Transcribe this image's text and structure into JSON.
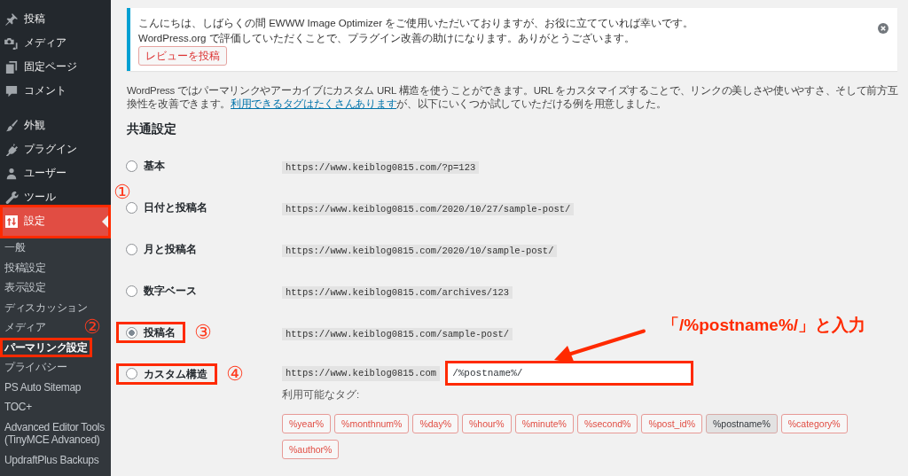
{
  "sidebar": {
    "groups": [
      {
        "items": [
          {
            "label": "投稿",
            "selected": false,
            "highlighted": false
          },
          {
            "label": "メディア",
            "selected": false,
            "highlighted": false
          },
          {
            "label": "固定ページ",
            "selected": false,
            "highlighted": false
          },
          {
            "label": "コメント",
            "selected": false,
            "highlighted": false
          }
        ]
      },
      {
        "items": [
          {
            "label": "外観",
            "selected": false,
            "highlighted": false
          },
          {
            "label": "プラグイン",
            "selected": false,
            "highlighted": false
          },
          {
            "label": "ユーザー",
            "selected": false,
            "highlighted": false
          },
          {
            "label": "ツール",
            "selected": false,
            "highlighted": false
          },
          {
            "label": "設定",
            "selected": true,
            "highlighted": true,
            "callout": "①",
            "submenu": [
              {
                "label": "一般",
                "selected": false,
                "highlighted": false
              },
              {
                "label": "投稿設定",
                "selected": false,
                "highlighted": false
              },
              {
                "label": "表示設定",
                "selected": false,
                "highlighted": false
              },
              {
                "label": "ディスカッション",
                "selected": false,
                "highlighted": false
              },
              {
                "label": "メディア",
                "selected": false,
                "highlighted": false
              },
              {
                "label": "パーマリンク設定",
                "selected": true,
                "highlighted": true,
                "callout": "②"
              },
              {
                "label": "プライバシー",
                "selected": false,
                "highlighted": false
              },
              {
                "label": "PS Auto Sitemap",
                "selected": false,
                "highlighted": false
              },
              {
                "label": "TOC+",
                "selected": false,
                "highlighted": false
              },
              {
                "label": "Advanced Editor Tools (TinyMCE Advanced)",
                "selected": false,
                "highlighted": false
              },
              {
                "label": "UpdraftPlus Backups",
                "selected": false,
                "highlighted": false
              }
            ]
          }
        ]
      }
    ]
  },
  "notice": {
    "lines": [
      "こんにちは、しばらくの間 EWWW Image Optimizer をご使用いただいておりますが、お役に立てていれば幸いです。",
      "WordPress.org で評価していただくことで、プラグイン改善の助けになります。ありがとうございます。"
    ],
    "button": "レビューを投稿"
  },
  "intro": {
    "text": "WordPress ではパーマリンクやアーカイブにカスタム URL 構造を使うことができます。URL をカスタマイズすることで、リンクの美しさや使いやすさ、そして前方互換性を改善できます。",
    "link": "利用できるタグはたくさんあります",
    "text_after": "が、以下にいくつか試していただける例を用意しました。"
  },
  "section_title": "共通設定",
  "options": [
    {
      "kind": "preset",
      "label": "基本",
      "url": "https://www.keiblog0815.com/?p=123",
      "selected": false,
      "highlighted": false
    },
    {
      "kind": "preset",
      "label": "日付と投稿名",
      "url": "https://www.keiblog0815.com/2020/10/27/sample-post/",
      "selected": false,
      "highlighted": false
    },
    {
      "kind": "preset",
      "label": "月と投稿名",
      "url": "https://www.keiblog0815.com/2020/10/sample-post/",
      "selected": false,
      "highlighted": false
    },
    {
      "kind": "preset",
      "label": "数字ベース",
      "url": "https://www.keiblog0815.com/archives/123",
      "selected": false,
      "highlighted": false
    },
    {
      "kind": "preset",
      "label": "投稿名",
      "url": "https://www.keiblog0815.com/sample-post/",
      "selected": true,
      "highlighted": true,
      "callout": "③"
    },
    {
      "kind": "custom",
      "label": "カスタム構造",
      "url": "https://www.keiblog0815.com",
      "selected": false,
      "highlighted": true,
      "callout": "④",
      "input": {
        "value": "/%postname%/",
        "highlighted": true
      },
      "tags_label": "利用可能なタグ:",
      "tags": [
        {
          "label": "%year%",
          "selected": false
        },
        {
          "label": "%monthnum%",
          "selected": false
        },
        {
          "label": "%day%",
          "selected": false
        },
        {
          "label": "%hour%",
          "selected": false
        },
        {
          "label": "%minute%",
          "selected": false
        },
        {
          "label": "%second%",
          "selected": false
        },
        {
          "label": "%post_id%",
          "selected": false
        },
        {
          "label": "%postname%",
          "selected": true
        },
        {
          "label": "%category%",
          "selected": false
        },
        {
          "label": "%author%",
          "selected": false
        }
      ]
    }
  ],
  "annotation": {
    "text": "「/%postname%/」と入力"
  }
}
